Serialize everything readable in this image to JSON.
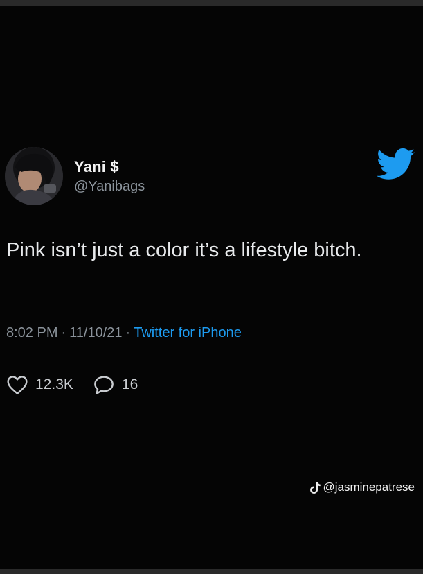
{
  "tweet": {
    "display_name": "Yani $",
    "handle": "@Yanibags",
    "text": "Pink isn’t just a color it’s a lifestyle bitch.",
    "time": "8:02 PM",
    "date": "11/10/21",
    "source": "Twitter for iPhone",
    "likes": "12.3K",
    "replies": "16"
  },
  "watermark": {
    "handle": "@jasminepatrese",
    "icon": "tiktok-icon"
  },
  "colors": {
    "background": "#050505",
    "accent": "#1d9bf0",
    "secondary_text": "#8b939b"
  }
}
